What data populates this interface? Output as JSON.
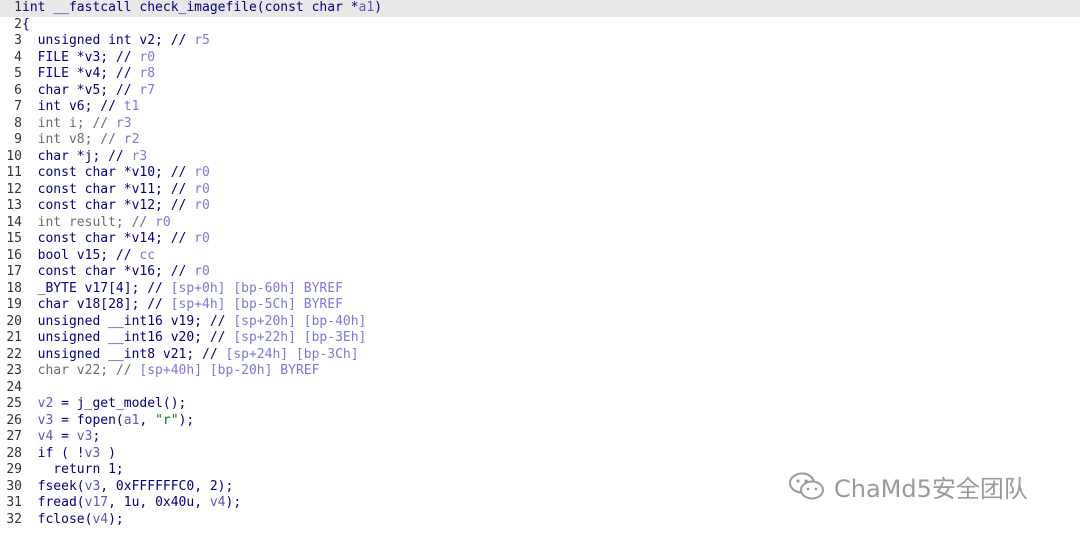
{
  "code_lines": [
    {
      "n": "1",
      "parts": [
        {
          "t": "int __fastcall check_imagefile(const char *",
          "c": "c"
        },
        {
          "t": "a1",
          "c": "v"
        },
        {
          "t": ")",
          "c": "c"
        }
      ]
    },
    {
      "n": "2",
      "parts": [
        {
          "t": "{",
          "c": "c"
        }
      ]
    },
    {
      "n": "3",
      "parts": [
        {
          "t": "  unsigned int v2; // ",
          "c": "c"
        },
        {
          "t": "r5",
          "c": "r"
        }
      ]
    },
    {
      "n": "4",
      "parts": [
        {
          "t": "  FILE *v3; // ",
          "c": "c"
        },
        {
          "t": "r0",
          "c": "r"
        }
      ]
    },
    {
      "n": "5",
      "parts": [
        {
          "t": "  FILE *v4; // ",
          "c": "c"
        },
        {
          "t": "r8",
          "c": "r"
        }
      ]
    },
    {
      "n": "6",
      "parts": [
        {
          "t": "  char *v5; // ",
          "c": "c"
        },
        {
          "t": "r7",
          "c": "r"
        }
      ]
    },
    {
      "n": "7",
      "parts": [
        {
          "t": "  int v6; // ",
          "c": "c"
        },
        {
          "t": "t1",
          "c": "r"
        }
      ]
    },
    {
      "n": "8",
      "parts": [
        {
          "t": "  int i; // ",
          "c": "g"
        },
        {
          "t": "r3",
          "c": "r"
        }
      ]
    },
    {
      "n": "9",
      "parts": [
        {
          "t": "  int v8; // ",
          "c": "g"
        },
        {
          "t": "r2",
          "c": "r"
        }
      ]
    },
    {
      "n": "10",
      "parts": [
        {
          "t": "  char *j; // ",
          "c": "c"
        },
        {
          "t": "r3",
          "c": "r"
        }
      ]
    },
    {
      "n": "11",
      "parts": [
        {
          "t": "  const char *v10; // ",
          "c": "c"
        },
        {
          "t": "r0",
          "c": "r"
        }
      ]
    },
    {
      "n": "12",
      "parts": [
        {
          "t": "  const char *v11; // ",
          "c": "c"
        },
        {
          "t": "r0",
          "c": "r"
        }
      ]
    },
    {
      "n": "13",
      "parts": [
        {
          "t": "  const char *v12; // ",
          "c": "c"
        },
        {
          "t": "r0",
          "c": "r"
        }
      ]
    },
    {
      "n": "14",
      "parts": [
        {
          "t": "  int result; // ",
          "c": "g"
        },
        {
          "t": "r0",
          "c": "r"
        }
      ]
    },
    {
      "n": "15",
      "parts": [
        {
          "t": "  const char *v14; // ",
          "c": "c"
        },
        {
          "t": "r0",
          "c": "r"
        }
      ]
    },
    {
      "n": "16",
      "parts": [
        {
          "t": "  bool v15; // ",
          "c": "c"
        },
        {
          "t": "cc",
          "c": "r"
        }
      ]
    },
    {
      "n": "17",
      "parts": [
        {
          "t": "  const char *v16; // ",
          "c": "c"
        },
        {
          "t": "r0",
          "c": "r"
        }
      ]
    },
    {
      "n": "18",
      "parts": [
        {
          "t": "  _BYTE v17[4]; // ",
          "c": "c"
        },
        {
          "t": "[sp+0h] [bp-60h] BYREF",
          "c": "r"
        }
      ]
    },
    {
      "n": "19",
      "parts": [
        {
          "t": "  char v18[28]; // ",
          "c": "c"
        },
        {
          "t": "[sp+4h] [bp-5Ch] BYREF",
          "c": "r"
        }
      ]
    },
    {
      "n": "20",
      "parts": [
        {
          "t": "  unsigned __int16 v19; // ",
          "c": "c"
        },
        {
          "t": "[sp+20h] [bp-40h]",
          "c": "r"
        }
      ]
    },
    {
      "n": "21",
      "parts": [
        {
          "t": "  unsigned __int16 v20; // ",
          "c": "c"
        },
        {
          "t": "[sp+22h] [bp-3Eh]",
          "c": "r"
        }
      ]
    },
    {
      "n": "22",
      "parts": [
        {
          "t": "  unsigned __int8 v21; // ",
          "c": "c"
        },
        {
          "t": "[sp+24h] [bp-3Ch]",
          "c": "r"
        }
      ]
    },
    {
      "n": "23",
      "parts": [
        {
          "t": "  char v22; // ",
          "c": "g"
        },
        {
          "t": "[sp+40h] [bp-20h] BYREF",
          "c": "r"
        }
      ]
    },
    {
      "n": "24",
      "parts": [
        {
          "t": "",
          "c": "c"
        }
      ]
    },
    {
      "n": "25",
      "parts": [
        {
          "t": "  ",
          "c": "c"
        },
        {
          "t": "v2",
          "c": "v"
        },
        {
          "t": " = j_get_model();",
          "c": "c"
        }
      ]
    },
    {
      "n": "26",
      "parts": [
        {
          "t": "  ",
          "c": "c"
        },
        {
          "t": "v3",
          "c": "v"
        },
        {
          "t": " = fopen(",
          "c": "c"
        },
        {
          "t": "a1",
          "c": "v"
        },
        {
          "t": ", ",
          "c": "c"
        },
        {
          "t": "\"r\"",
          "c": "s"
        },
        {
          "t": ");",
          "c": "c"
        }
      ]
    },
    {
      "n": "27",
      "parts": [
        {
          "t": "  ",
          "c": "c"
        },
        {
          "t": "v4",
          "c": "v"
        },
        {
          "t": " = ",
          "c": "c"
        },
        {
          "t": "v3",
          "c": "v"
        },
        {
          "t": ";",
          "c": "c"
        }
      ]
    },
    {
      "n": "28",
      "parts": [
        {
          "t": "  if ( !",
          "c": "c"
        },
        {
          "t": "v3",
          "c": "v"
        },
        {
          "t": " )",
          "c": "c"
        }
      ]
    },
    {
      "n": "29",
      "parts": [
        {
          "t": "    return 1;",
          "c": "c"
        }
      ]
    },
    {
      "n": "30",
      "parts": [
        {
          "t": "  fseek(",
          "c": "c"
        },
        {
          "t": "v3",
          "c": "v"
        },
        {
          "t": ", 0xFFFFFFC0, 2);",
          "c": "c"
        }
      ]
    },
    {
      "n": "31",
      "parts": [
        {
          "t": "  fread(",
          "c": "c"
        },
        {
          "t": "v17",
          "c": "v"
        },
        {
          "t": ", 1u, 0x40u, ",
          "c": "c"
        },
        {
          "t": "v4",
          "c": "v"
        },
        {
          "t": ");",
          "c": "c"
        }
      ]
    },
    {
      "n": "32",
      "parts": [
        {
          "t": "  fclose(",
          "c": "c"
        },
        {
          "t": "v4",
          "c": "v"
        },
        {
          "t": ");",
          "c": "c"
        }
      ]
    }
  ],
  "watermark": {
    "text": "ChaMd5安全团队",
    "icon": "wechat-icon"
  },
  "colors": {
    "highlight_line": "#e8e8e8",
    "code": "#000080",
    "register": "#7a7ad6",
    "string": "#008000"
  }
}
